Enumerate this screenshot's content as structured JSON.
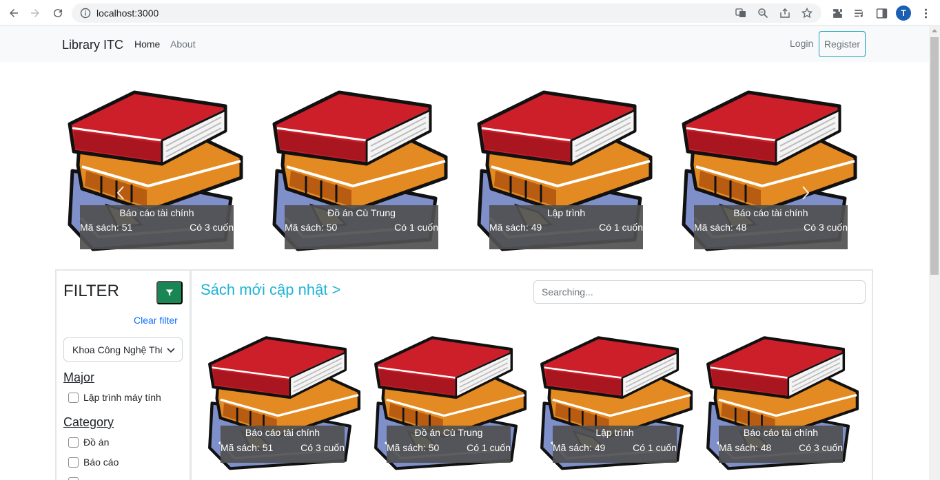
{
  "browser": {
    "url": "localhost:3000",
    "avatar_letter": "T"
  },
  "navbar": {
    "brand": "Library ITC",
    "links": [
      "Home",
      "About"
    ],
    "login": "Login",
    "register": "Register"
  },
  "carousel": {
    "slides": [
      {
        "title": "Báo cáo tài chính",
        "code": "Mã sách: 51",
        "count": "Có 3 cuốn"
      },
      {
        "title": "Đồ án Cù Trung",
        "code": "Mã sách: 50",
        "count": "Có 1 cuốn"
      },
      {
        "title": "Lập trình",
        "code": "Mã sách: 49",
        "count": "Có 1 cuốn"
      },
      {
        "title": "Báo cáo tài chính",
        "code": "Mã sách: 48",
        "count": "Có 3 cuốn"
      }
    ]
  },
  "filter": {
    "title": "FILTER",
    "clear": "Clear filter",
    "faculty_selected": "Khoa Công Nghệ Thông Tin",
    "major_heading": "Major",
    "majors": [
      "Lập trình máy tính"
    ],
    "category_heading": "Category",
    "categories": [
      "Đồ án",
      "Báo cáo"
    ]
  },
  "content": {
    "heading": "Sách mới cập nhật >",
    "search_placeholder": "Searching...",
    "books": [
      {
        "title": "Báo cáo tài chính",
        "code": "Mã sách: 51",
        "count": "Có 3 cuốn"
      },
      {
        "title": "Đồ án Cù Trung",
        "code": "Mã sách: 50",
        "count": "Có 1 cuốn"
      },
      {
        "title": "Lập trình",
        "code": "Mã sách: 49",
        "count": "Có 1 cuốn"
      },
      {
        "title": "Báo cáo tài chính",
        "code": "Mã sách: 48",
        "count": "Có 3 cuốn"
      }
    ]
  },
  "colors": {
    "accent": "#1eb3d6",
    "filter_button": "#198754",
    "register_border": "#17a2b8",
    "link": "#0d6efd"
  }
}
